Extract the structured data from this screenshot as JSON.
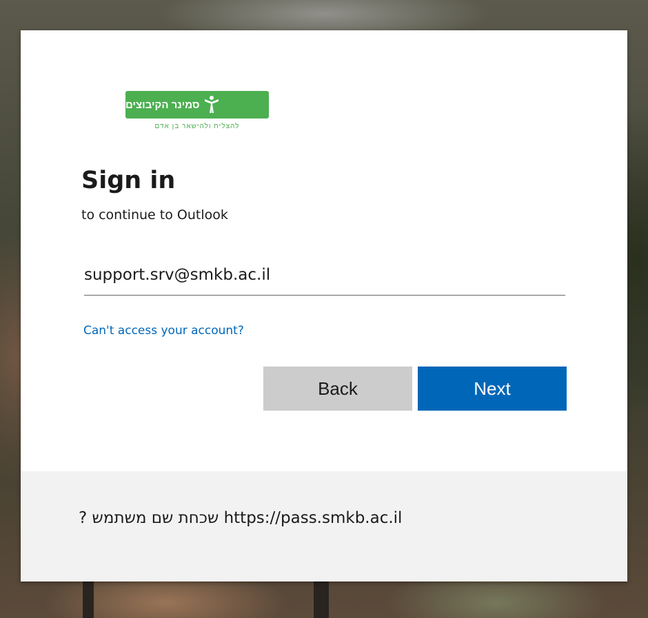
{
  "logo": {
    "name_hebrew": "סמינר הקיבוצים",
    "tagline_hebrew": "להצליח ולהישאר בן אדם",
    "brand_color": "#4caf50"
  },
  "signin": {
    "title": "Sign in",
    "subtitle": "to continue to Outlook",
    "email_value": "support.srv@smkb.ac.il",
    "cant_access_link": "Can't access your account?",
    "back_label": "Back",
    "next_label": "Next"
  },
  "footer": {
    "text": "? שכחת שם משתמש https://pass.smkb.ac.il"
  },
  "colors": {
    "primary_button": "#0067b8",
    "secondary_button": "#cccccc",
    "link": "#0067b8",
    "footer_bg": "#f2f2f2"
  }
}
